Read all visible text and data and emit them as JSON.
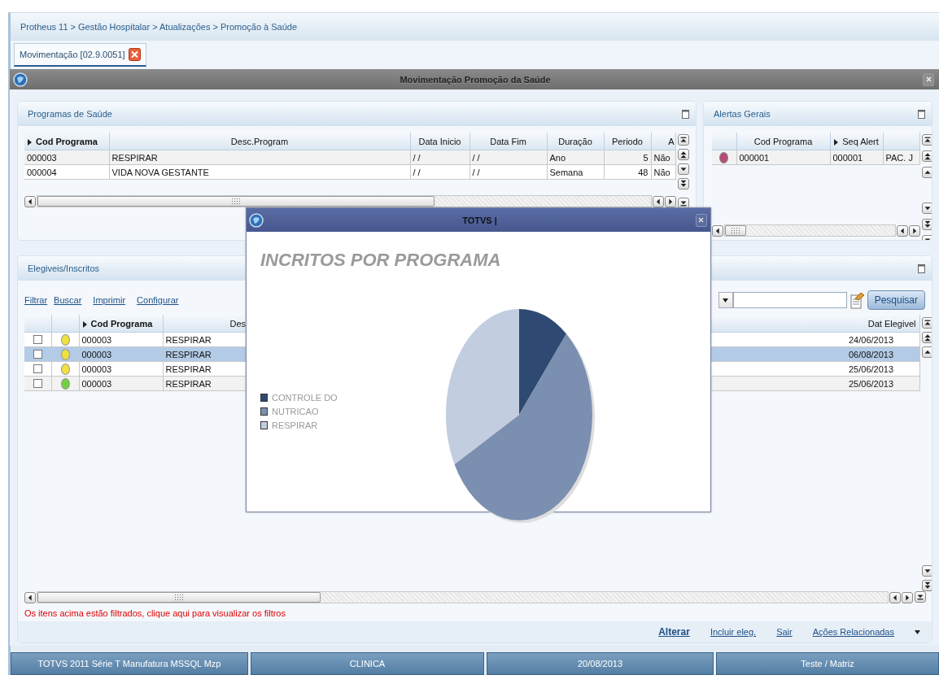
{
  "breadcrumb": "Protheus 11 > Gestão Hospitalar > Atualizações > Promoção à Saúde",
  "tabs": [
    {
      "label": "Movimentação [02.9.0051]",
      "selected": true
    }
  ],
  "window": {
    "title": "Movimentação Promoção da Saúde"
  },
  "programs_panel": {
    "title": "Programas de Saúde",
    "columns": [
      "Cod Programa",
      "Desc.Program",
      "Data Inicio",
      "Data Fim",
      "Duração",
      "Periodo",
      "A"
    ],
    "rows": [
      [
        "000003",
        "RESPIRAR",
        "/ /",
        "/ /",
        "Ano",
        "5",
        "Não"
      ],
      [
        "000004",
        "VIDA NOVA GESTANTE",
        "/ /",
        "/ /",
        "Semana",
        "48",
        "Não"
      ]
    ]
  },
  "alerts_panel": {
    "title": "Alertas Gerais",
    "columns": [
      "Cod Programa",
      "Seq Alert"
    ],
    "rows": [
      {
        "color": "#b84a78",
        "cells": [
          "000001",
          "000001",
          "PAC. J"
        ]
      }
    ]
  },
  "eligible_panel": {
    "title": "Elegiveis/Inscritos",
    "links": [
      "Filtrar",
      "Buscar",
      "Imprimir",
      "Configurar"
    ],
    "search_button": "Pesquisar",
    "columns": [
      "Cod Programa",
      "Des",
      "Dat Elegivel"
    ],
    "rows": [
      {
        "checked": false,
        "color": "#f0e040",
        "selected": false,
        "cells": [
          "000003",
          "RESPIRAR",
          "24/06/2013"
        ]
      },
      {
        "checked": false,
        "color": "#f0e040",
        "selected": true,
        "cells": [
          "000003",
          "RESPIRAR",
          "06/08/2013"
        ]
      },
      {
        "checked": false,
        "color": "#f0e040",
        "selected": false,
        "cells": [
          "000003",
          "RESPIRAR",
          "25/06/2013"
        ]
      },
      {
        "checked": false,
        "color": "#70d040",
        "selected": false,
        "cells": [
          "000003",
          "RESPIRAR",
          "25/06/2013"
        ]
      }
    ],
    "filter_notice": "Os itens acima estão filtrados, clique aqui para visualizar os filtros",
    "actions": [
      "Alterar",
      "Incluir eleg.",
      "Sair",
      "Ações Relacionadas"
    ]
  },
  "dialog": {
    "title": "TOTVS |",
    "chart_title": "INCRITOS POR PROGRAMA",
    "legend": [
      {
        "label": "CONTROLE DO",
        "color": "#2e4a72"
      },
      {
        "label": "NUTRICAO",
        "color": "#7b8fb0"
      },
      {
        "label": "RESPIRAR",
        "color": "#c3cde0"
      }
    ]
  },
  "status_bar": [
    "TOTVS 2011 Série T Manufatura MSSQL Mzp",
    "CLINICA",
    "20/08/2013",
    "Teste / Matriz"
  ]
}
